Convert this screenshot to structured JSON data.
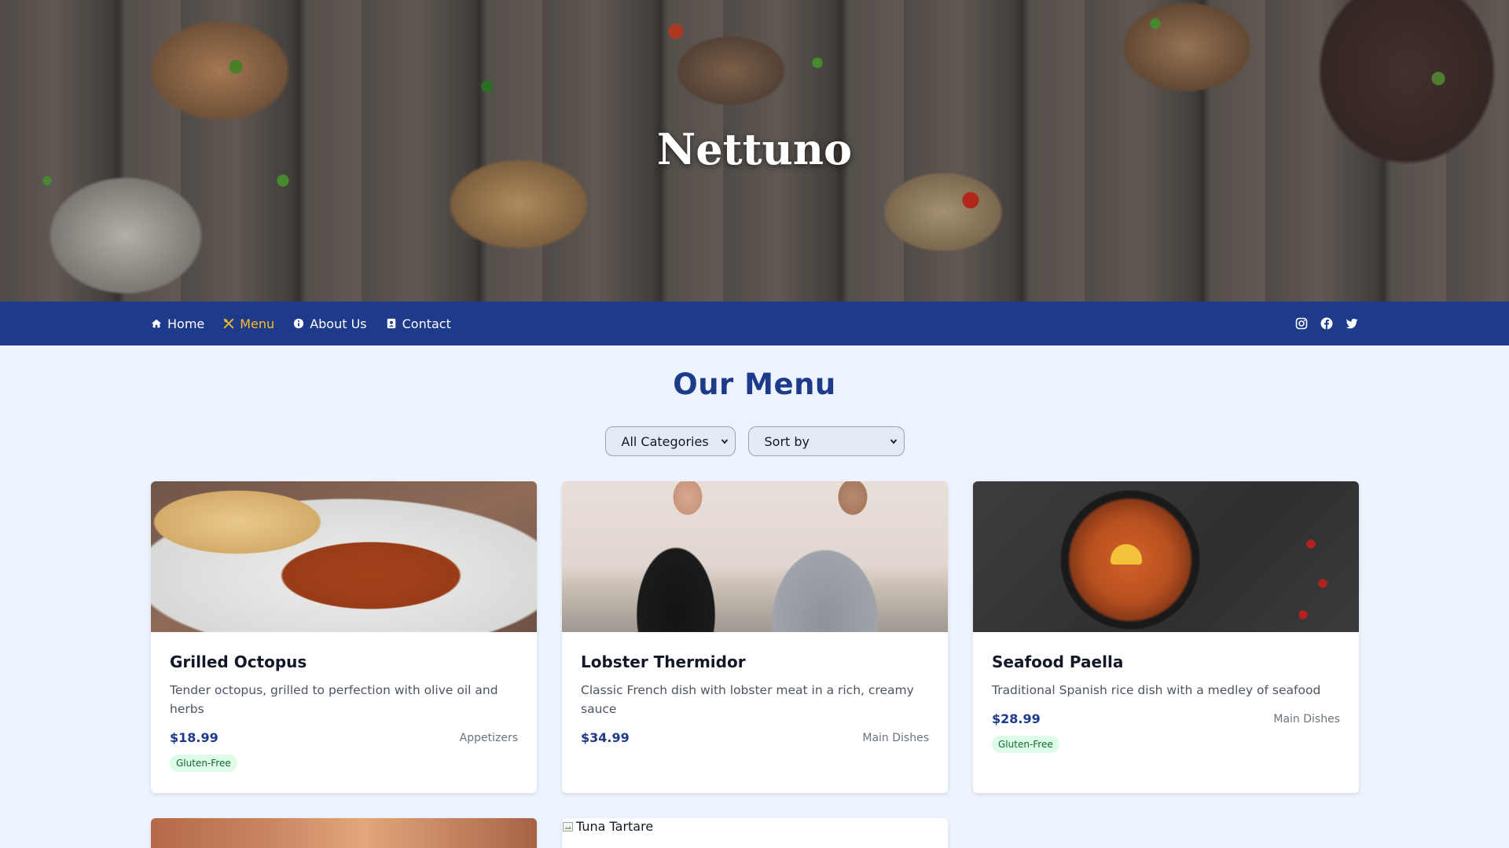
{
  "hero": {
    "title": "Nettuno"
  },
  "nav": {
    "items": [
      {
        "label": "Home",
        "icon": "home-icon",
        "active": false
      },
      {
        "label": "Menu",
        "icon": "utensils-icon",
        "active": true
      },
      {
        "label": "About Us",
        "icon": "info-icon",
        "active": false
      },
      {
        "label": "Contact",
        "icon": "contact-card-icon",
        "active": false
      }
    ],
    "social": [
      "instagram-icon",
      "facebook-icon",
      "twitter-icon"
    ]
  },
  "main": {
    "title": "Our Menu",
    "filters": {
      "category_selected": "All Categories",
      "sort_selected": "Sort by"
    },
    "cards": [
      {
        "title": "Grilled Octopus",
        "description": "Tender octopus, grilled to perfection with olive oil and herbs",
        "price": "$18.99",
        "category": "Appetizers",
        "badge": "Gluten-Free"
      },
      {
        "title": "Lobster Thermidor",
        "description": "Classic French dish with lobster meat in a rich, creamy sauce",
        "price": "$34.99",
        "category": "Main Dishes",
        "badge": ""
      },
      {
        "title": "Seafood Paella",
        "description": "Traditional Spanish rice dish with a medley of seafood",
        "price": "$28.99",
        "category": "Main Dishes",
        "badge": "Gluten-Free"
      }
    ],
    "partial_cards": [
      {
        "alt": ""
      },
      {
        "alt": "Tuna Tartare"
      }
    ]
  },
  "colors": {
    "nav_bg": "#1e3a8a",
    "accent": "#fbbf24",
    "price": "#1e3a8a",
    "badge_bg": "#dcfce7",
    "badge_text": "#166534",
    "page_bg": "#eef4fd"
  }
}
